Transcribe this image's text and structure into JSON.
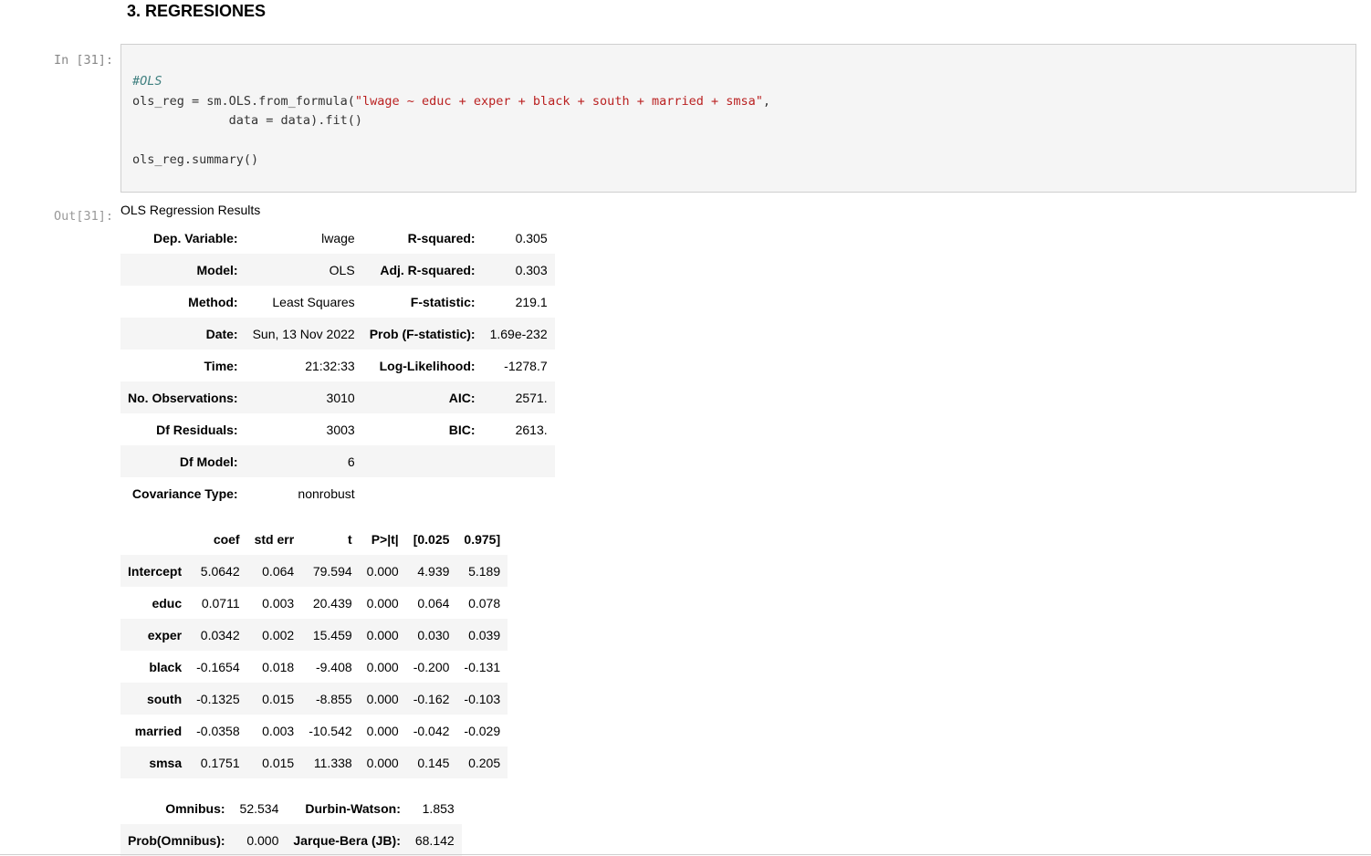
{
  "heading": "3. REGRESIONES",
  "in_prompt": "In [31]:",
  "out_prompt": "Out[31]:",
  "code": {
    "comment": "#OLS",
    "line1_pre": "ols_reg = sm.OLS.from_formula(",
    "line1_str": "\"lwage ~ educ + exper + black + south + married + smsa\"",
    "line1_post": ",",
    "line2": "             data = data).fit()",
    "line4": "ols_reg.summary()"
  },
  "caption": "OLS Regression Results",
  "summary_top": [
    [
      "Dep. Variable:",
      "lwage",
      "R-squared:",
      "0.305"
    ],
    [
      "Model:",
      "OLS",
      "Adj. R-squared:",
      "0.303"
    ],
    [
      "Method:",
      "Least Squares",
      "F-statistic:",
      "219.1"
    ],
    [
      "Date:",
      "Sun, 13 Nov 2022",
      "Prob (F-statistic):",
      "1.69e-232"
    ],
    [
      "Time:",
      "21:32:33",
      "Log-Likelihood:",
      "-1278.7"
    ],
    [
      "No. Observations:",
      "3010",
      "AIC:",
      "2571."
    ],
    [
      "Df Residuals:",
      "3003",
      "BIC:",
      "2613."
    ],
    [
      "Df Model:",
      "6",
      "",
      ""
    ],
    [
      "Covariance Type:",
      "nonrobust",
      "",
      ""
    ]
  ],
  "coef_headers": [
    "",
    "coef",
    "std err",
    "t",
    "P>|t|",
    "[0.025",
    "0.975]"
  ],
  "coef_rows": [
    [
      "Intercept",
      "5.0642",
      "0.064",
      "79.594",
      "0.000",
      "4.939",
      "5.189"
    ],
    [
      "educ",
      "0.0711",
      "0.003",
      "20.439",
      "0.000",
      "0.064",
      "0.078"
    ],
    [
      "exper",
      "0.0342",
      "0.002",
      "15.459",
      "0.000",
      "0.030",
      "0.039"
    ],
    [
      "black",
      "-0.1654",
      "0.018",
      "-9.408",
      "0.000",
      "-0.200",
      "-0.131"
    ],
    [
      "south",
      "-0.1325",
      "0.015",
      "-8.855",
      "0.000",
      "-0.162",
      "-0.103"
    ],
    [
      "married",
      "-0.0358",
      "0.003",
      "-10.542",
      "0.000",
      "-0.042",
      "-0.029"
    ],
    [
      "smsa",
      "0.1751",
      "0.015",
      "11.338",
      "0.000",
      "0.145",
      "0.205"
    ]
  ],
  "diag_rows": [
    [
      "Omnibus:",
      "52.534",
      "Durbin-Watson:",
      "1.853"
    ],
    [
      "Prob(Omnibus):",
      "0.000",
      "Jarque-Bera (JB):",
      "68.142"
    ]
  ]
}
